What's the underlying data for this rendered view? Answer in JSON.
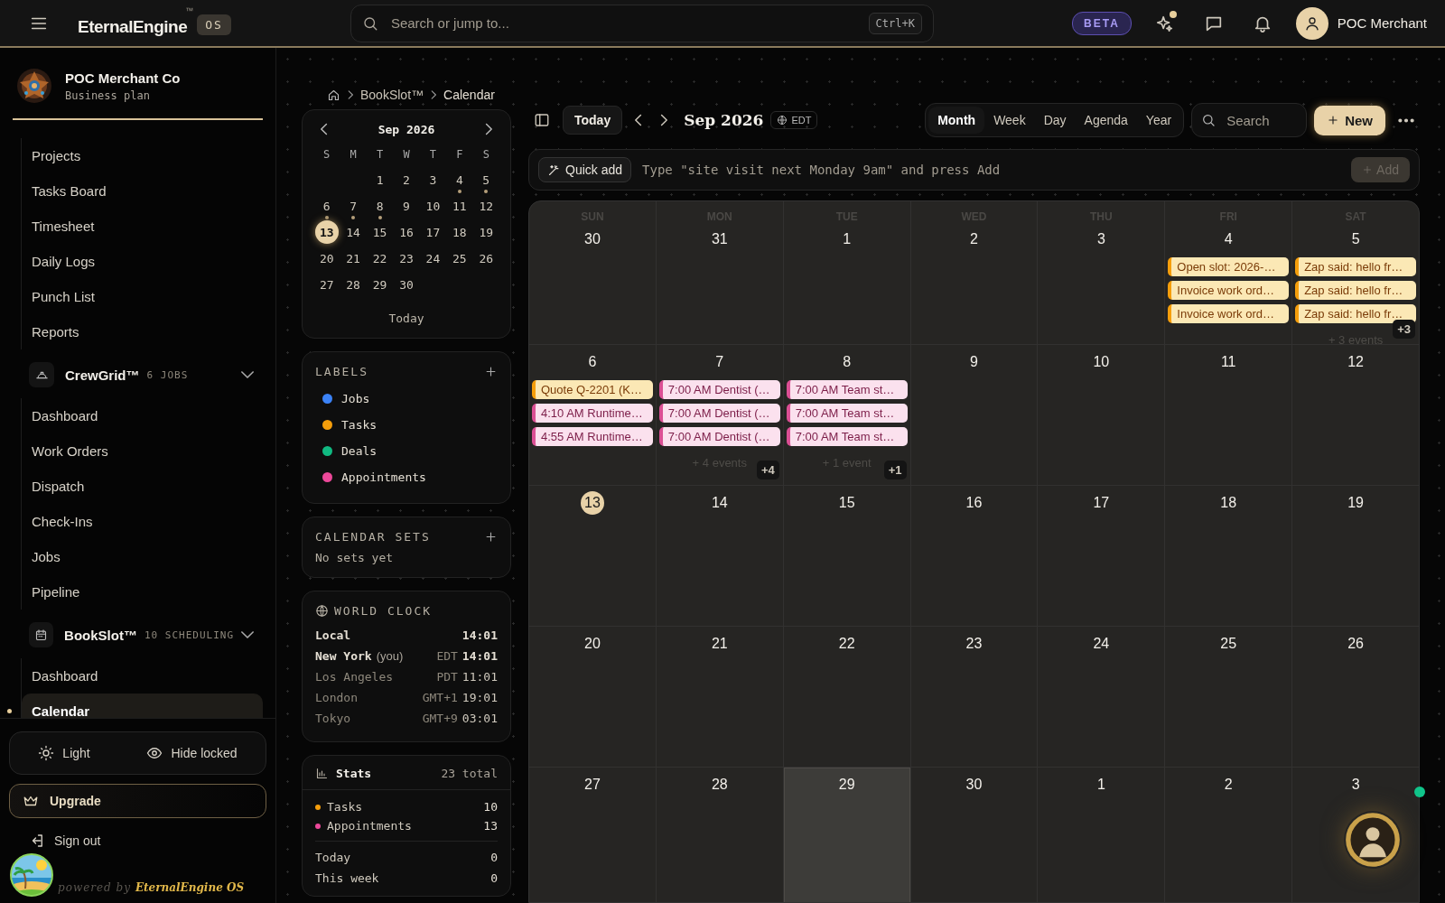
{
  "topbar": {
    "brand": "EternalEngine",
    "brand_mark": "™",
    "os_badge": "OS",
    "search": {
      "placeholder": "Search or jump to...",
      "shortcut": "Ctrl+K"
    },
    "beta": "BETA",
    "user_name": "POC Merchant"
  },
  "sidebar": {
    "org": {
      "name": "POC Merchant Co",
      "plan": "Business plan"
    },
    "sections": [
      {
        "items": [
          {
            "label": "Projects",
            "selected": false
          },
          {
            "label": "Tasks Board",
            "selected": false
          },
          {
            "label": "Timesheet",
            "selected": false
          },
          {
            "label": "Daily Logs",
            "selected": false
          },
          {
            "label": "Punch List",
            "selected": false
          },
          {
            "label": "Reports",
            "selected": false
          }
        ]
      },
      {
        "title": "CrewGrid™",
        "meta": "6 JOBS",
        "expanded": true,
        "items": [
          {
            "label": "Dashboard",
            "selected": false
          },
          {
            "label": "Work Orders",
            "selected": false
          },
          {
            "label": "Dispatch",
            "selected": false
          },
          {
            "label": "Check-Ins",
            "selected": false
          },
          {
            "label": "Jobs",
            "selected": false
          },
          {
            "label": "Pipeline",
            "selected": false
          }
        ]
      },
      {
        "title": "BookSlot™",
        "meta": "10 SCHEDULING",
        "expanded": true,
        "items": [
          {
            "label": "Dashboard",
            "selected": false
          },
          {
            "label": "Calendar",
            "selected": true
          }
        ]
      }
    ],
    "footer": {
      "theme": "Light",
      "hide_locked": "Hide locked",
      "upgrade": "Upgrade",
      "sign_out": "Sign out",
      "powered_by": "powered by",
      "powered_brand": "EternalEngine OS"
    }
  },
  "breadcrumb": [
    "BookSlot™",
    "Calendar"
  ],
  "mini_calendar": {
    "title": "Sep 2026",
    "weekdays": [
      "S",
      "M",
      "T",
      "W",
      "T",
      "F",
      "S"
    ],
    "weeks": [
      [
        {
          "day": "1",
          "selected": false,
          "marked": false
        },
        {
          "day": "2",
          "selected": false,
          "marked": false
        },
        {
          "day": "3",
          "selected": false,
          "marked": false
        },
        {
          "day": "4",
          "selected": false,
          "marked": true
        },
        {
          "day": "5",
          "selected": false,
          "marked": true
        }
      ],
      [
        {
          "day": "6",
          "selected": false,
          "marked": true
        },
        {
          "day": "7",
          "selected": false,
          "marked": true
        },
        {
          "day": "8",
          "selected": false,
          "marked": true
        },
        {
          "day": "9",
          "selected": false,
          "marked": false
        },
        {
          "day": "10",
          "selected": false,
          "marked": false
        },
        {
          "day": "11",
          "selected": false,
          "marked": false
        },
        {
          "day": "12",
          "selected": false,
          "marked": false
        }
      ],
      [
        {
          "day": "13",
          "selected": true,
          "marked": false
        },
        {
          "day": "14",
          "selected": false,
          "marked": false
        },
        {
          "day": "15",
          "selected": false,
          "marked": false
        },
        {
          "day": "16",
          "selected": false,
          "marked": false
        },
        {
          "day": "17",
          "selected": false,
          "marked": false
        },
        {
          "day": "18",
          "selected": false,
          "marked": false
        },
        {
          "day": "19",
          "selected": false,
          "marked": false
        }
      ],
      [
        {
          "day": "20",
          "selected": false,
          "marked": false
        },
        {
          "day": "21",
          "selected": false,
          "marked": false
        },
        {
          "day": "22",
          "selected": false,
          "marked": false
        },
        {
          "day": "23",
          "selected": false,
          "marked": false
        },
        {
          "day": "24",
          "selected": false,
          "marked": false
        },
        {
          "day": "25",
          "selected": false,
          "marked": false
        },
        {
          "day": "26",
          "selected": false,
          "marked": false
        }
      ],
      [
        {
          "day": "27",
          "selected": false,
          "marked": false
        },
        {
          "day": "28",
          "selected": false,
          "marked": false
        },
        {
          "day": "29",
          "selected": false,
          "marked": false
        },
        {
          "day": "30",
          "selected": false,
          "marked": false
        }
      ]
    ],
    "today_button": "Today"
  },
  "labels": {
    "title": "LABELS",
    "items": [
      {
        "name": "Jobs",
        "color": "#3b82f6"
      },
      {
        "name": "Tasks",
        "color": "#f59e0b"
      },
      {
        "name": "Deals",
        "color": "#10b981"
      },
      {
        "name": "Appointments",
        "color": "#ec4899"
      }
    ]
  },
  "calendar_sets": {
    "title": "CALENDAR SETS",
    "empty_text": "No sets yet"
  },
  "world_clock": {
    "title": "WORLD CLOCK",
    "rows": [
      {
        "city": "Local",
        "time": "14:01",
        "highlighted": true
      },
      {
        "city": "New York",
        "note": "(you)",
        "zone": "EDT",
        "time": "14:01",
        "highlighted": true
      },
      {
        "city": "Los Angeles",
        "zone": "PDT",
        "time": "11:01",
        "highlighted": false
      },
      {
        "city": "London",
        "zone": "GMT+1",
        "time": "19:01",
        "highlighted": false
      },
      {
        "city": "Tokyo",
        "zone": "GMT+9",
        "time": "03:01",
        "highlighted": false
      }
    ]
  },
  "stats": {
    "title": "Stats",
    "total": "23 total",
    "items": [
      {
        "label": "Tasks",
        "value": "10",
        "color": "#f59e0b"
      },
      {
        "label": "Appointments",
        "value": "13",
        "color": "#ec4899"
      }
    ],
    "summary": [
      {
        "label": "Today",
        "value": "0"
      },
      {
        "label": "This week",
        "value": "0"
      }
    ]
  },
  "calendar": {
    "toolbar": {
      "today": "Today",
      "title": "Sep 2026",
      "timezone": "EDT",
      "views": [
        {
          "label": "Month",
          "selected": true
        },
        {
          "label": "Week",
          "selected": false
        },
        {
          "label": "Day",
          "selected": false
        },
        {
          "label": "Agenda",
          "selected": false
        },
        {
          "label": "Year",
          "selected": false
        }
      ],
      "search": {
        "placeholder": "Search"
      },
      "new_button": "New"
    },
    "quick_add": {
      "button": "Quick add",
      "placeholder": "Type \"site visit next Monday 9am\" and press Add",
      "add_button": {
        "label": "Add",
        "disabled": true
      }
    },
    "weekdays": [
      "SUN",
      "MON",
      "TUE",
      "WED",
      "THU",
      "FRI",
      "SAT"
    ],
    "weeks": [
      [
        {
          "day": "30",
          "today": false,
          "selected": false
        },
        {
          "day": "31",
          "today": false,
          "selected": false
        },
        {
          "day": "1",
          "today": false,
          "selected": false
        },
        {
          "day": "2",
          "today": false,
          "selected": false
        },
        {
          "day": "3",
          "today": false,
          "selected": false
        },
        {
          "day": "4",
          "today": false,
          "selected": false,
          "events": [
            {
              "title": "Open slot: 2026-…",
              "kind": "task"
            },
            {
              "title": "Invoice work ord…",
              "kind": "task"
            },
            {
              "title": "Invoice work ord…",
              "kind": "task"
            }
          ]
        },
        {
          "day": "5",
          "today": false,
          "selected": false,
          "events": [
            {
              "title": "Zap said: hello fr…",
              "kind": "task"
            },
            {
              "title": "Zap said: hello fr…",
              "kind": "task"
            },
            {
              "title": "Zap said: hello fr…",
              "kind": "task"
            }
          ],
          "more_text": "+ 3 events",
          "more_badge": "+3"
        }
      ],
      [
        {
          "day": "6",
          "today": false,
          "selected": false,
          "events": [
            {
              "title": "Quote Q-2201 (K…",
              "kind": "task"
            },
            {
              "title": "4:10 AM Runtime…",
              "kind": "appointment"
            },
            {
              "title": "4:55 AM Runtime…",
              "kind": "appointment"
            }
          ]
        },
        {
          "day": "7",
          "today": false,
          "selected": false,
          "events": [
            {
              "title": "7:00 AM Dentist (…",
              "kind": "appointment"
            },
            {
              "title": "7:00 AM Dentist (…",
              "kind": "appointment"
            },
            {
              "title": "7:00 AM Dentist (…",
              "kind": "appointment"
            }
          ],
          "more_text": "+ 4 events",
          "more_badge": "+4"
        },
        {
          "day": "8",
          "today": false,
          "selected": false,
          "events": [
            {
              "title": "7:00 AM Team st…",
              "kind": "appointment"
            },
            {
              "title": "7:00 AM Team st…",
              "kind": "appointment"
            },
            {
              "title": "7:00 AM Team st…",
              "kind": "appointment"
            }
          ],
          "more_text": "+ 1 event",
          "more_badge": "+1"
        },
        {
          "day": "9",
          "today": false,
          "selected": false
        },
        {
          "day": "10",
          "today": false,
          "selected": false
        },
        {
          "day": "11",
          "today": false,
          "selected": false
        },
        {
          "day": "12",
          "today": false,
          "selected": false
        }
      ],
      [
        {
          "day": "13",
          "today": true,
          "selected": false
        },
        {
          "day": "14",
          "today": false,
          "selected": false
        },
        {
          "day": "15",
          "today": false,
          "selected": false
        },
        {
          "day": "16",
          "today": false,
          "selected": false
        },
        {
          "day": "17",
          "today": false,
          "selected": false
        },
        {
          "day": "18",
          "today": false,
          "selected": false
        },
        {
          "day": "19",
          "today": false,
          "selected": false
        }
      ],
      [
        {
          "day": "20",
          "today": false,
          "selected": false
        },
        {
          "day": "21",
          "today": false,
          "selected": false
        },
        {
          "day": "22",
          "today": false,
          "selected": false
        },
        {
          "day": "23",
          "today": false,
          "selected": false
        },
        {
          "day": "24",
          "today": false,
          "selected": false
        },
        {
          "day": "25",
          "today": false,
          "selected": false
        },
        {
          "day": "26",
          "today": false,
          "selected": false
        }
      ],
      [
        {
          "day": "27",
          "today": false,
          "selected": false
        },
        {
          "day": "28",
          "today": false,
          "selected": false
        },
        {
          "day": "29",
          "today": false,
          "selected": true
        },
        {
          "day": "30",
          "today": false,
          "selected": false
        },
        {
          "day": "1",
          "today": false,
          "selected": false
        },
        {
          "day": "2",
          "today": false,
          "selected": false
        },
        {
          "day": "3",
          "today": false,
          "selected": false
        }
      ]
    ]
  }
}
